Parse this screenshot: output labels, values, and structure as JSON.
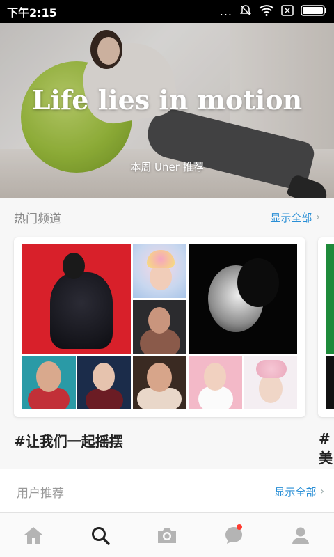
{
  "status_bar": {
    "time": "下午2:15",
    "icons": [
      "more-dots-icon",
      "mute-bell-icon",
      "wifi-icon",
      "sim-x-icon",
      "battery-icon"
    ],
    "dots": "..."
  },
  "hero": {
    "title": "Life lies in motion",
    "subtitle": "本周 Uner 推荐"
  },
  "hot_channels": {
    "title": "热门频道",
    "show_all": "显示全部",
    "chevron": "›",
    "channels": [
      {
        "name": "#让我们一起摇摆"
      },
      {
        "name": "#美"
      }
    ]
  },
  "user_recommend": {
    "title": "用户推荐",
    "show_all": "显示全部",
    "chevron": "›"
  },
  "tab_bar": {
    "tabs": [
      {
        "icon": "home-icon"
      },
      {
        "icon": "search-icon",
        "active": true
      },
      {
        "icon": "camera-icon"
      },
      {
        "icon": "message-icon",
        "badge": true
      },
      {
        "icon": "profile-icon"
      }
    ],
    "colors": {
      "active": "#222222",
      "inactive": "#b4b4b4",
      "badge": "#ff3b30"
    }
  },
  "colors": {
    "accent_link": "#2a8fd6",
    "status_bar_bg": "#000000"
  }
}
